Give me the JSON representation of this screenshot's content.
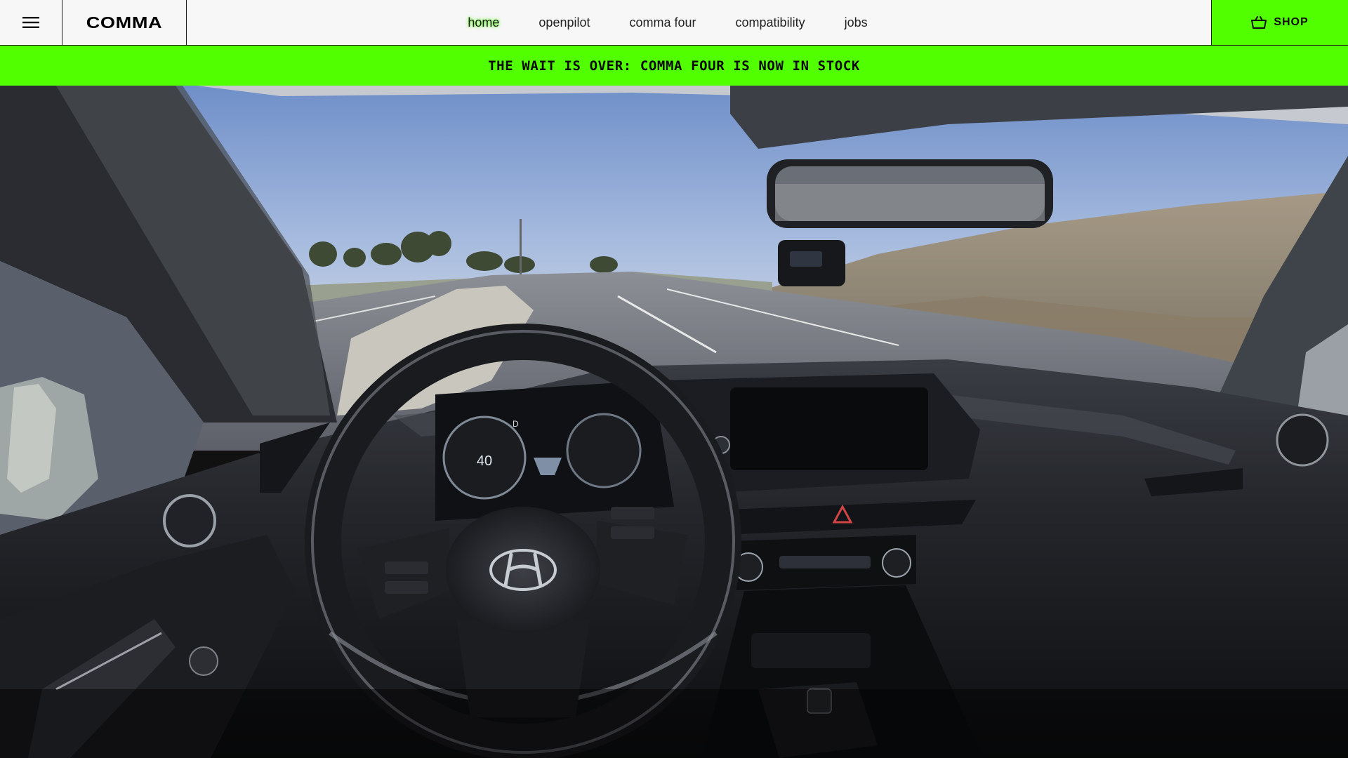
{
  "header": {
    "menu_icon": "hamburger-menu-icon",
    "logo": "COMMA",
    "nav": [
      {
        "label": "home",
        "active": true
      },
      {
        "label": "openpilot",
        "active": false
      },
      {
        "label": "comma four",
        "active": false
      },
      {
        "label": "compatibility",
        "active": false
      },
      {
        "label": "jobs",
        "active": false
      }
    ],
    "shop": {
      "label": "SHOP",
      "icon": "basket-icon"
    }
  },
  "banner": {
    "text": "THE WAIT IS OVER: COMMA FOUR IS NOW IN STOCK"
  },
  "hero": {
    "speed": "40",
    "gear": "D"
  },
  "colors": {
    "accent_green": "#51ff00",
    "header_bg": "#f7f7f7",
    "border": "#1e1e1e"
  }
}
